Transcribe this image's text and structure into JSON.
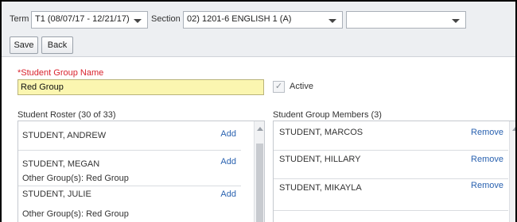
{
  "toolbar": {
    "term_label": "Term",
    "term_value": "T1 (08/07/17 - 12/21/17)",
    "section_label": "Section",
    "section_value": "02) 1201-6 ENGLISH 1 (A)",
    "extra_select_value": "",
    "save_label": "Save",
    "back_label": "Back"
  },
  "form": {
    "group_name_label": "*Student Group Name",
    "group_name_value": "Red Group",
    "active_label": "Active",
    "active_checked": true
  },
  "roster": {
    "title": "Student Roster (30 of 33)",
    "add_label": "Add",
    "students": [
      {
        "name": "STUDENT, ANDREW",
        "other_groups": ""
      },
      {
        "name": "STUDENT, MEGAN",
        "other_groups": "Other Group(s): Red Group"
      },
      {
        "name": "STUDENT, JULIE",
        "other_groups": "Other Group(s): Red Group"
      }
    ]
  },
  "members": {
    "title": "Student Group Members (3)",
    "remove_label": "Remove",
    "students": [
      {
        "name": "STUDENT, MARCOS"
      },
      {
        "name": "STUDENT, HILLARY"
      },
      {
        "name": "STUDENT, MIKAYLA"
      }
    ]
  },
  "colors": {
    "required_label": "#d9232d",
    "link": "#2a62b0",
    "name_field_bg": "#fbf6b0",
    "toolbar_bg": "#edeff2"
  }
}
